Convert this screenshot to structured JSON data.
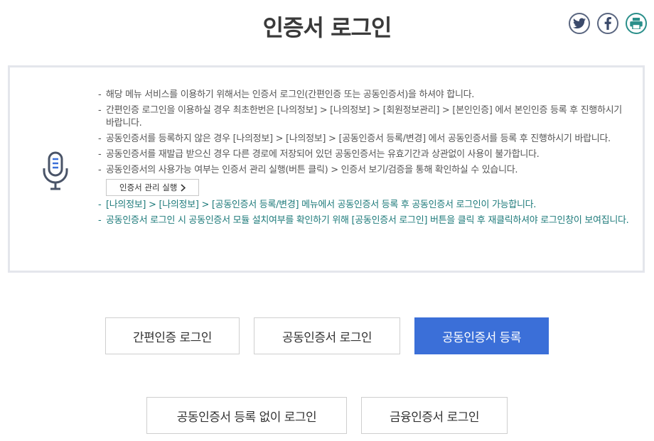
{
  "page": {
    "title": "인증서 로그인"
  },
  "share": {
    "twitter_icon": "twitter-icon",
    "facebook_icon": "facebook-icon",
    "print_icon": "print-icon"
  },
  "notice": {
    "icon": "microphone-icon",
    "items": [
      "해당 메뉴 서비스를 이용하기 위해서는 인증서 로그인(간편인증 또는 공동인증서)을 하셔야 합니다.",
      "간편인증 로그인을 이용하실 경우 최초한번은 [나의정보] > [나의정보] > [회원정보관리] > [본인인증] 에서 본인인증 등록 후 진행하시기 바랍니다.",
      "공동인증서를 등록하지 않은 경우 [나의정보] > [나의정보] > [공동인증서 등록/변경] 에서 공동인증서를 등록 후 진행하시기 바랍니다.",
      "공동인증서를 재발급 받으신 경우 다른 경로에 저장되어 있던 공동인증서는 유효기간과 상관없이 사용이 불가합니다.",
      "공동인증서의 사용가능 여부는 인증서 관리 실행(버튼 클릭) > 인증서 보기/검증을 통해 확인하실 수 있습니다."
    ],
    "manage_button": "인증서 관리 실행",
    "teal_items": [
      "[나의정보] > [나의정보] > [공동인증서 등록/변경] 메뉴에서 공동인증서 등록 후 공동인증서 로그인이 가능합니다.",
      "공동인증서 로그인 시 공동인증서 모듈 설치여부를 확인하기 위해 [공동인증서 로그인] 버튼을 클릭 후 재클릭하셔야 로그인창이 보여집니다."
    ]
  },
  "buttons": {
    "simple_login": "간편인증 로그인",
    "joint_cert_login": "공동인증서 로그인",
    "joint_cert_register": "공동인증서 등록",
    "login_without_register": "공동인증서 등록 없이 로그인",
    "financial_cert_login": "금융인증서 로그인"
  },
  "colors": {
    "primary": "#3b6fd8",
    "teal_text": "#1d7a7a",
    "share_border": "#5a6680",
    "print_border": "#2a8f8a"
  }
}
